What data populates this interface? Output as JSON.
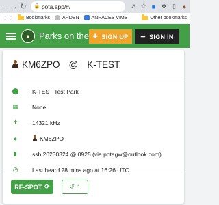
{
  "browser": {
    "url": "pota.app/#/",
    "bookmarks": [
      {
        "label": "Bookmarks",
        "icon": "folder-icon"
      },
      {
        "label": "ARDEN",
        "icon": "site-icon"
      },
      {
        "label": "ANRACES VIMS",
        "icon": "site-icon"
      }
    ],
    "other_bookmarks": "Other bookmarks"
  },
  "appbar": {
    "title": "Parks on the Air",
    "signup_label": "SIGN UP",
    "signin_label": "SIGN IN"
  },
  "spot": {
    "activator": "KM6ZPO",
    "at": "@",
    "park": "K-TEST",
    "details": {
      "park_name": "K-TEST  Test Park",
      "grid": "None",
      "frequency": "14321 kHz",
      "spotter": "KM6ZPO",
      "comment": "ssb 20230324 @ 0925 (via potagw@outlook.com)",
      "last_heard": "Last heard 28 mins ago at 16:26 UTC"
    },
    "respot_label": "RE-SPOT",
    "history_count": "1"
  },
  "colors": {
    "primary_green": "#43a047",
    "signup_orange": "#f0a52a",
    "signin_dark": "#222222"
  }
}
